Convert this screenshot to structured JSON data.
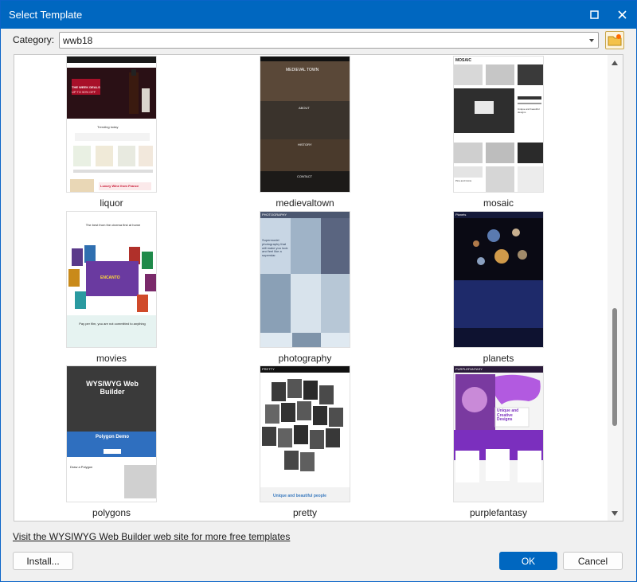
{
  "window": {
    "title": "Select Template"
  },
  "category": {
    "label": "Category:",
    "value": "wwb18"
  },
  "templates": [
    {
      "name": "liquor",
      "texts": [
        "THE WEEK DEALS",
        "UP TO 50% OFF",
        "Trending today",
        "Luxury Wine from France"
      ]
    },
    {
      "name": "medievaltown",
      "texts": [
        "MEDIEVAL TOWN",
        "ABOUT",
        "HISTORY",
        "CONTACT"
      ]
    },
    {
      "name": "mosaic",
      "texts": [
        "MOSAIC",
        "Unique and beautiful designs",
        "Pins and Coins"
      ]
    },
    {
      "name": "movies",
      "texts": [
        "The best from the cinema first at home",
        "ENCANTO",
        "Pay per film, you are not committed to anything"
      ]
    },
    {
      "name": "photography",
      "texts": [
        "PHOTOGRAPHY",
        "Supermodel photography that will make you look and feel like a superstar."
      ]
    },
    {
      "name": "planets",
      "texts": [
        "Planets"
      ]
    },
    {
      "name": "polygons",
      "texts": [
        "WYSIWYG Web Builder",
        "Polygon Demo",
        "Draw a Polygon"
      ]
    },
    {
      "name": "pretty",
      "texts": [
        "PRETTY",
        "Unique and beautiful people"
      ]
    },
    {
      "name": "purplefantasy",
      "texts": [
        "PURPLEFANTASY",
        "Unique and Creative Designs"
      ]
    }
  ],
  "footer": {
    "link": "Visit the WYSIWYG Web Builder web site for more free templates",
    "install": "Install...",
    "ok": "OK",
    "cancel": "Cancel"
  },
  "colors": {
    "titlebar": "#0067c0",
    "accent": "#0067c0",
    "dialog_bg": "#f0f0f0"
  }
}
